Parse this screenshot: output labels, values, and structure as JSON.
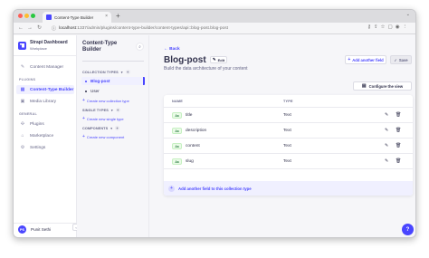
{
  "browser": {
    "tab_title": "Content-Type Builder",
    "tab_close": "×",
    "new_tab": "+",
    "tab_menu": "⌄",
    "url_host": "localhost",
    "url_path": ":1337/admin/plugins/content-type-builder/content-types/api::blog-post.blog-post"
  },
  "brand": {
    "title": "Strapi Dashboard",
    "subtitle": "Workplace"
  },
  "main_nav": {
    "content_manager": "Content Manager",
    "plugins_section": "PLUGINS",
    "content_type_builder": "Content-Type Builder",
    "media_library": "Media Library",
    "general_section": "GENERAL",
    "plugins": "Plugins",
    "marketplace": "Marketplace",
    "settings": "Settings"
  },
  "user": {
    "initials": "PS",
    "name": "Punit Sethi"
  },
  "sub_nav": {
    "title": "Content-Type Builder",
    "collection_types_label": "COLLECTION TYPES",
    "collection_types": [
      "Blog-post",
      "User"
    ],
    "create_collection": "Create new collection type",
    "single_types_label": "SINGLE TYPES",
    "create_single": "Create new single type",
    "components_label": "COMPONENTS",
    "create_component": "Create new component"
  },
  "header": {
    "back": "Back",
    "title": "Blog-post",
    "edit": "Edit",
    "subtitle": "Build the data architecture of your content",
    "add_field": "Add another field",
    "save": "Save",
    "configure": "Configure the view"
  },
  "table": {
    "col_name": "NAME",
    "col_type": "TYPE",
    "rows": [
      {
        "icon": "Aa",
        "name": "title",
        "type": "Text"
      },
      {
        "icon": "Aa",
        "name": "description",
        "type": "Text"
      },
      {
        "icon": "Aa",
        "name": "content",
        "type": "Text"
      },
      {
        "icon": "Aa",
        "name": "slug",
        "type": "Text"
      }
    ],
    "add_row": "Add another field to this collection type"
  },
  "help": "?",
  "colors": {
    "primary": "#4945ff",
    "text_green": "#328048",
    "bg": "#f6f6f9"
  }
}
